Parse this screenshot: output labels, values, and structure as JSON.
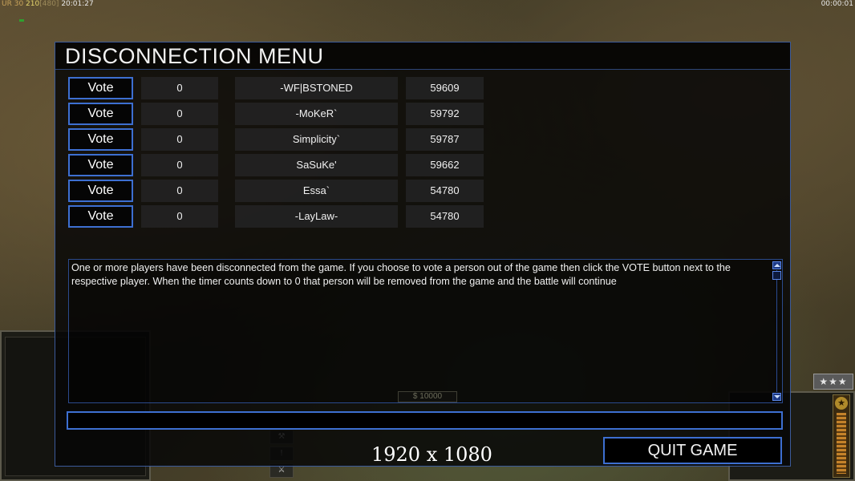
{
  "hud": {
    "ur_label": "UR",
    "ur_value": "30",
    "fps": "210",
    "fps_max": "[480]",
    "clock": "20:01:27",
    "game_timer": "00:00:01",
    "money": "$ 10000",
    "rank_stars": "★★★"
  },
  "dialog": {
    "title": "DISCONNECTION MENU",
    "vote_label": "Vote",
    "players": [
      {
        "votes": "0",
        "name": "-WF|BSTONED",
        "ping": "59609"
      },
      {
        "votes": "0",
        "name": "-MoKeR`",
        "ping": "59792"
      },
      {
        "votes": "0",
        "name": "Simplicity`",
        "ping": "59787"
      },
      {
        "votes": "0",
        "name": "SaSuKe'",
        "ping": "59662"
      },
      {
        "votes": "0",
        "name": "Essa`",
        "ping": "54780"
      },
      {
        "votes": "0",
        "name": "-LayLaw-",
        "ping": "54780"
      }
    ],
    "message": "One or more players have been disconnected from the game. If you choose to vote a person out of the game then click the VOTE button next to the respective player. When the timer counts down to 0 that person will be removed from the game and the battle will continue",
    "chat_value": "",
    "quit_label": "QUIT GAME"
  },
  "watermark": "1920 x 1080",
  "colors": {
    "accent_border": "#3d6fd1",
    "dialog_bg": "#060606",
    "cell_bg": "#222222"
  }
}
